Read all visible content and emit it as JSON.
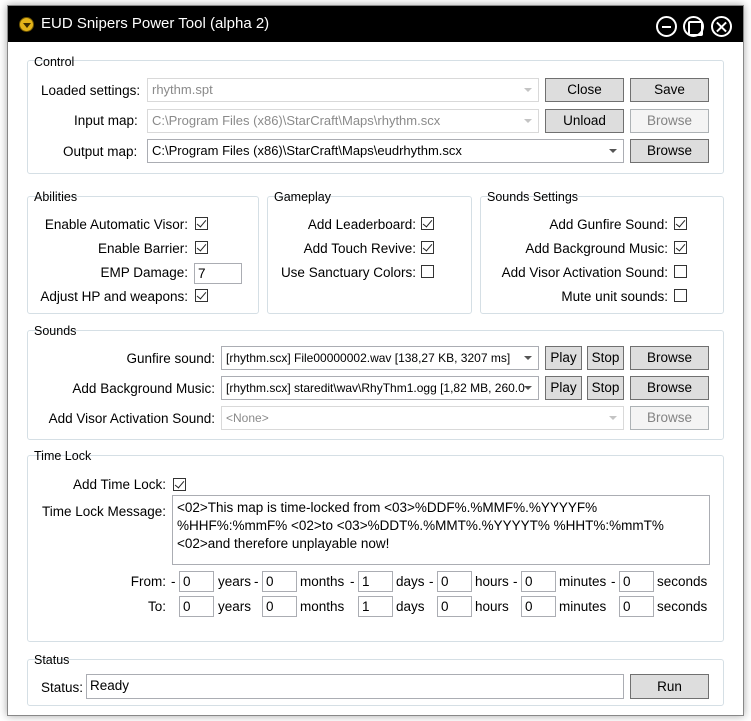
{
  "window": {
    "title": "EUD Snipers Power Tool (alpha 2)"
  },
  "control": {
    "title": "Control",
    "loaded_settings_label": "Loaded settings:",
    "loaded_settings_value": "rhythm.spt",
    "close_label": "Close",
    "save_label": "Save",
    "input_map_label": "Input map:",
    "input_map_value": "C:\\Program Files (x86)\\StarCraft\\Maps\\rhythm.scx",
    "unload_label": "Unload",
    "browse_input_label": "Browse",
    "output_map_label": "Output map:",
    "output_map_value": "C:\\Program Files (x86)\\StarCraft\\Maps\\eudrhythm.scx",
    "browse_output_label": "Browse"
  },
  "abilities": {
    "title": "Abilities",
    "automatic_visor_label": "Enable Automatic Visor:",
    "automatic_visor_checked": true,
    "barrier_label": "Enable Barrier:",
    "barrier_checked": true,
    "emp_damage_label": "EMP Damage:",
    "emp_damage_value": "7",
    "adjust_hp_label": "Adjust HP and weapons:",
    "adjust_hp_checked": true
  },
  "gameplay": {
    "title": "Gameplay",
    "leaderboard_label": "Add Leaderboard:",
    "leaderboard_checked": true,
    "touch_revive_label": "Add Touch Revive:",
    "touch_revive_checked": true,
    "sanctuary_colors_label": "Use Sanctuary Colors:",
    "sanctuary_colors_checked": false
  },
  "sounds_settings": {
    "title": "Sounds Settings",
    "gunfire_sound_label": "Add Gunfire Sound:",
    "gunfire_sound_checked": true,
    "background_music_label": "Add Background Music:",
    "background_music_checked": true,
    "visor_sound_label": "Add Visor Activation Sound:",
    "visor_sound_checked": false,
    "mute_unit_label": "Mute unit sounds:",
    "mute_unit_checked": false
  },
  "sounds": {
    "title": "Sounds",
    "gunfire_label": "Gunfire sound:",
    "gunfire_value": "[rhythm.scx] File00000002.wav [138,27 KB, 3207 ms]",
    "background_label": "Add Background Music:",
    "background_value": "[rhythm.scx] staredit\\wav\\RhyThm1.ogg [1,82 MB, 260.0",
    "visor_label": "Add Visor Activation Sound:",
    "visor_value": "<None>",
    "play_label": "Play",
    "stop_label": "Stop",
    "browse_label": "Browse"
  },
  "time_lock": {
    "title": "Time Lock",
    "add_label": "Add Time Lock:",
    "add_checked": true,
    "message_label": "Time Lock Message:",
    "message_value": "<02>This map is time-locked from <03>%DDF%.%MMF%.%YYYYF% %HHF%:%mmF% <02>to <03>%DDT%.%MMT%.%YYYYT% %HHT%:%mmT% <02>and therefore unplayable now!",
    "from_label": "From:",
    "to_label": "To:",
    "minus": "-",
    "years": "years",
    "months": "months",
    "days": "days",
    "hours": "hours",
    "minutes": "minutes",
    "seconds": "seconds",
    "from_years": "0",
    "from_months": "0",
    "from_days": "1",
    "from_hours": "0",
    "from_minutes": "0",
    "from_seconds": "0",
    "to_years": "0",
    "to_months": "0",
    "to_days": "1",
    "to_hours": "0",
    "to_minutes": "0",
    "to_seconds": "0"
  },
  "status": {
    "title": "Status",
    "label": "Status:",
    "value": "Ready",
    "run_label": "Run"
  }
}
